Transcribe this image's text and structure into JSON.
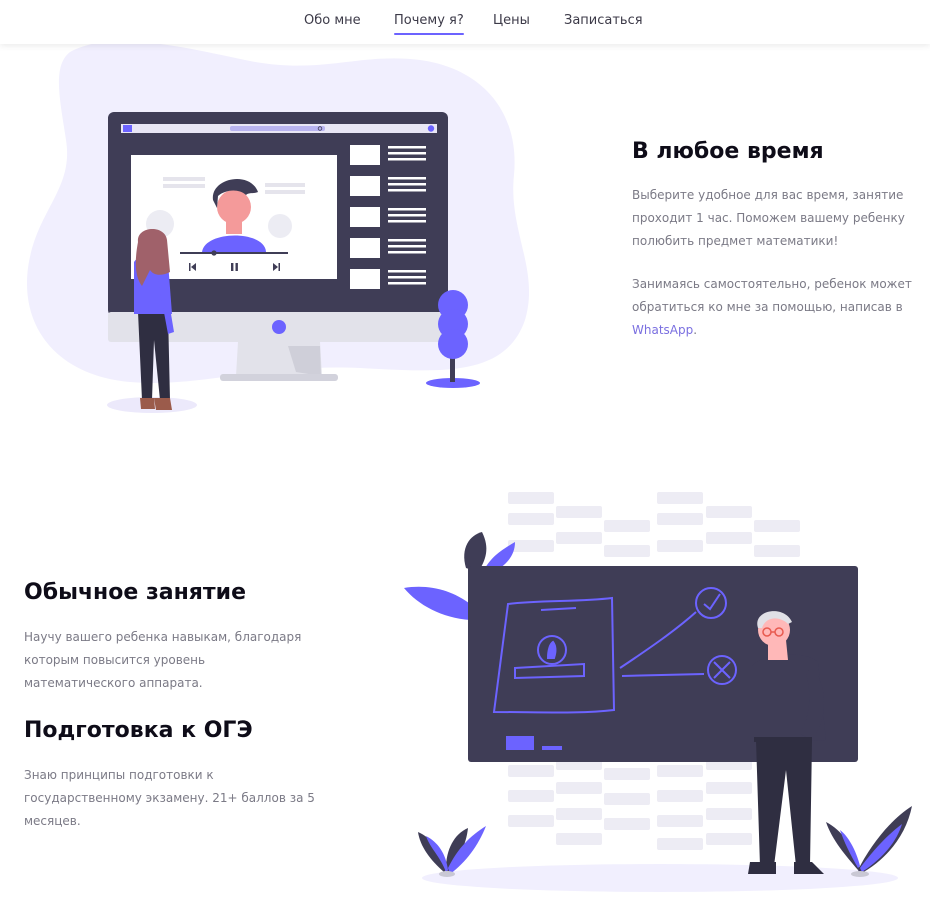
{
  "nav": {
    "items": [
      {
        "label": "Обо мне",
        "active": false
      },
      {
        "label": "Почему я?",
        "active": true
      },
      {
        "label": "Цены",
        "active": false
      },
      {
        "label": "Записаться",
        "active": false
      }
    ]
  },
  "section_anytime": {
    "title": "В любое время",
    "paragraph1": [
      "Выберите удобное для вас время, занятие",
      "проходит 1 час. Поможем вашему ребенку",
      "полюбить предмет математики!"
    ],
    "paragraph2_lines": [
      "Занимаясь самостоятельно, ребенок может",
      "обратиться ко мне за помощью, написав в"
    ],
    "paragraph2_link": "WhatsApp",
    "paragraph2_end": "."
  },
  "section_regular": {
    "title": "Обычное занятие",
    "lines": [
      "Научу вашего ребенка навыкам, благодаря",
      "которым повысится уровень",
      "математического аппарата."
    ]
  },
  "section_oge": {
    "title": "Подготовка к ОГЭ",
    "lines": [
      "Знаю принципы подготовки к",
      "государственному экзамену. 21+ баллов за 5",
      "месяцев."
    ]
  },
  "colors": {
    "accent": "#6c63ff",
    "dark": "#3f3d56",
    "blob": "#f1effe",
    "text_muted": "#7b7a86"
  },
  "icons": [
    "previous-icon",
    "pause-icon",
    "next-icon",
    "search-icon"
  ]
}
